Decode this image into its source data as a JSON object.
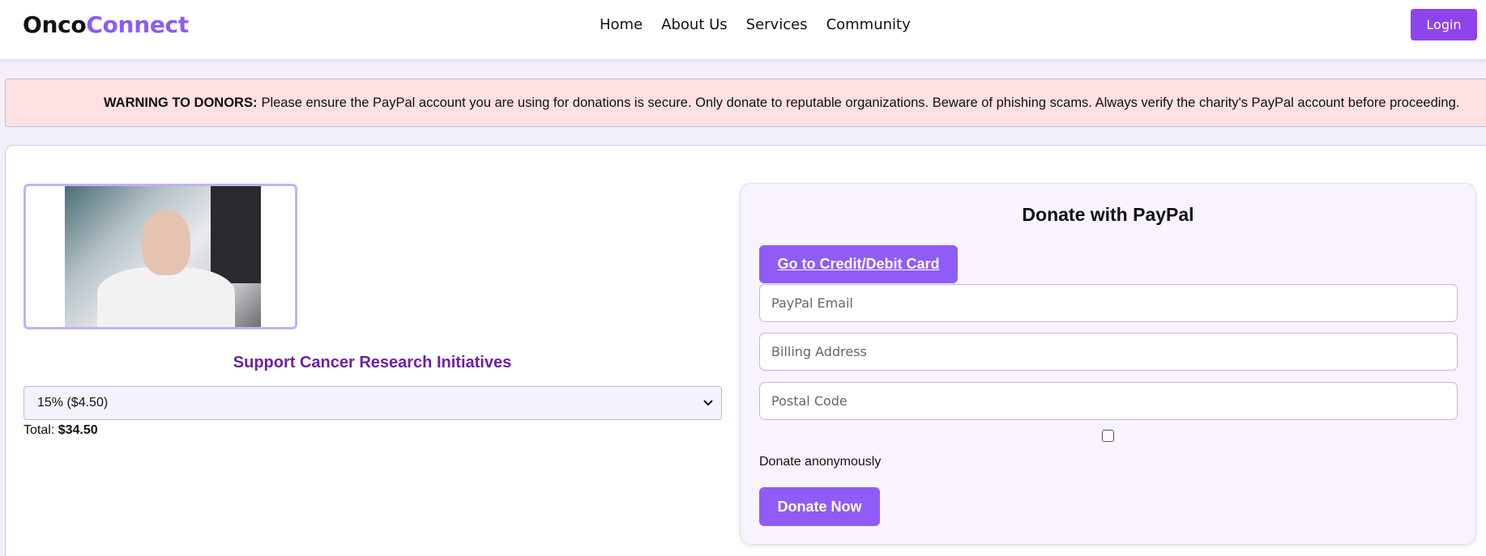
{
  "header": {
    "brand_part1": "Onco",
    "brand_part2": "Connect",
    "nav": [
      "Home",
      "About Us",
      "Services",
      "Community"
    ],
    "login_label": "Login"
  },
  "warning": {
    "label": "WARNING TO DONORS:",
    "text": "Please ensure the PayPal account you are using for donations is secure. Only donate to reputable organizations. Beware of phishing scams. Always verify the charity's PayPal account before proceeding."
  },
  "campaign": {
    "title": "Support Cancer Research Initiatives",
    "selected_amount": "15% ($4.50)",
    "total_label": "Total:",
    "total_value": "$34.50"
  },
  "donate": {
    "title": "Donate with PayPal",
    "card_button": "Go to Credit/Debit Card",
    "fields": {
      "email_placeholder": "PayPal Email",
      "address_placeholder": "Billing Address",
      "postal_placeholder": "Postal Code"
    },
    "anonymous_label": "Donate anonymously",
    "donate_button": "Donate Now"
  },
  "colors": {
    "accent": "#8b5cf6",
    "title_purple": "#6b21a8",
    "warning_bg": "#ffe0e3"
  }
}
